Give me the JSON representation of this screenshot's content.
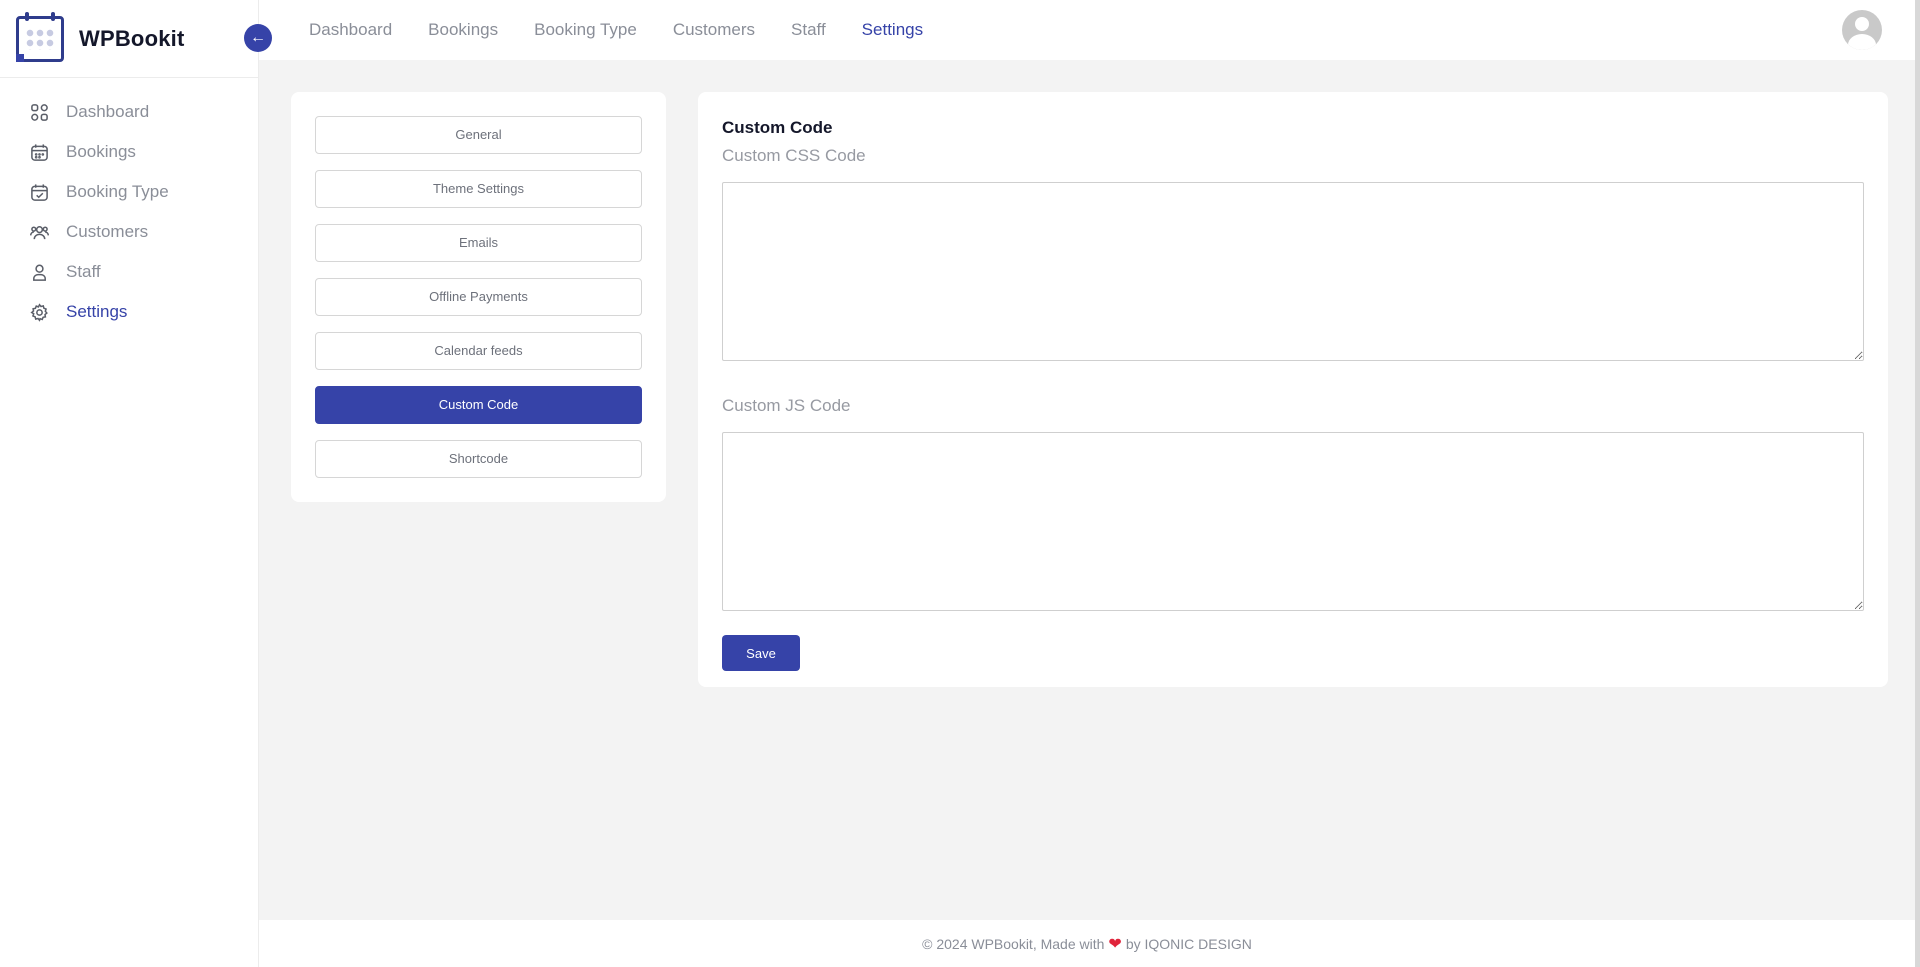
{
  "brand": {
    "name": "WPBookit"
  },
  "sidebar": {
    "items": [
      {
        "label": "Dashboard",
        "icon": "dashboard-grid-icon",
        "active": false
      },
      {
        "label": "Bookings",
        "icon": "calendar-icon",
        "active": false
      },
      {
        "label": "Booking Type",
        "icon": "calendar-check-icon",
        "active": false
      },
      {
        "label": "Customers",
        "icon": "users-icon",
        "active": false
      },
      {
        "label": "Staff",
        "icon": "user-icon",
        "active": false
      },
      {
        "label": "Settings",
        "icon": "gear-icon",
        "active": true
      }
    ]
  },
  "topnav": {
    "items": [
      {
        "label": "Dashboard",
        "active": false
      },
      {
        "label": "Bookings",
        "active": false
      },
      {
        "label": "Booking Type",
        "active": false
      },
      {
        "label": "Customers",
        "active": false
      },
      {
        "label": "Staff",
        "active": false
      },
      {
        "label": "Settings",
        "active": true
      }
    ]
  },
  "settings_menu": {
    "items": [
      {
        "label": "General",
        "active": false
      },
      {
        "label": "Theme Settings",
        "active": false
      },
      {
        "label": "Emails",
        "active": false
      },
      {
        "label": "Offline Payments",
        "active": false
      },
      {
        "label": "Calendar feeds",
        "active": false
      },
      {
        "label": "Custom Code",
        "active": true
      },
      {
        "label": "Shortcode",
        "active": false
      }
    ]
  },
  "main": {
    "title": "Custom Code",
    "css_label": "Custom CSS Code",
    "css_value": "",
    "js_label": "Custom JS Code",
    "js_value": "",
    "save_label": "Save"
  },
  "footer": {
    "prefix": "© 2024 WPBookit, Made with",
    "suffix": "by IQONIC DESIGN"
  },
  "colors": {
    "accent": "#3643a8",
    "heart": "#e0243b",
    "background": "#f3f3f3"
  }
}
